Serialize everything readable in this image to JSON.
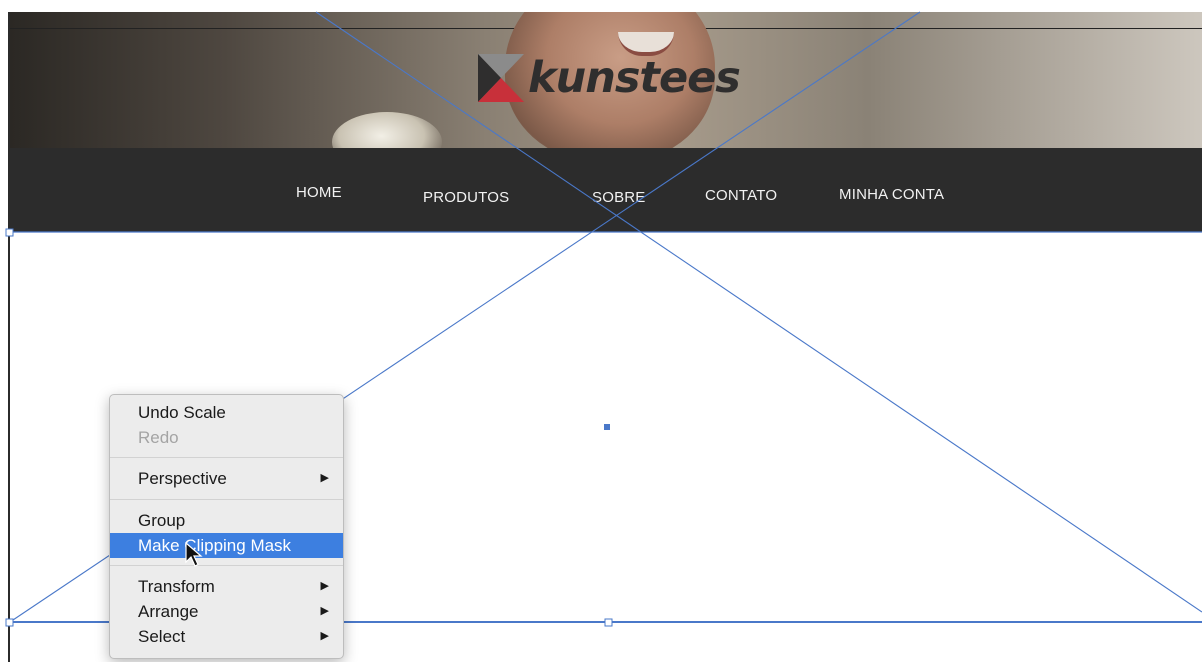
{
  "header": {
    "logo_text": "kunstees",
    "brand_colors": {
      "red": "#c8303a",
      "dark": "#2f2e2e",
      "grey": "#8b8b8b"
    }
  },
  "nav": {
    "items": [
      {
        "label": "HOME"
      },
      {
        "label": "PRODUTOS"
      },
      {
        "label": "SOBRE"
      },
      {
        "label": "CONTATO"
      },
      {
        "label": "MINHA CONTA"
      }
    ],
    "background": "#2c2c2c"
  },
  "guide_color": "#4a78c9",
  "context_menu": {
    "highlight_color": "#3d7fe0",
    "items": [
      {
        "label": "Undo Scale",
        "enabled": true
      },
      {
        "label": "Redo",
        "enabled": false
      },
      {
        "label": "Perspective",
        "submenu": true
      },
      {
        "label": "Group"
      },
      {
        "label": "Make Clipping Mask",
        "selected": true
      },
      {
        "label": "Transform",
        "submenu": true
      },
      {
        "label": "Arrange",
        "submenu": true
      },
      {
        "label": "Select",
        "submenu": true
      }
    ],
    "submenu_arrow": "▶"
  }
}
